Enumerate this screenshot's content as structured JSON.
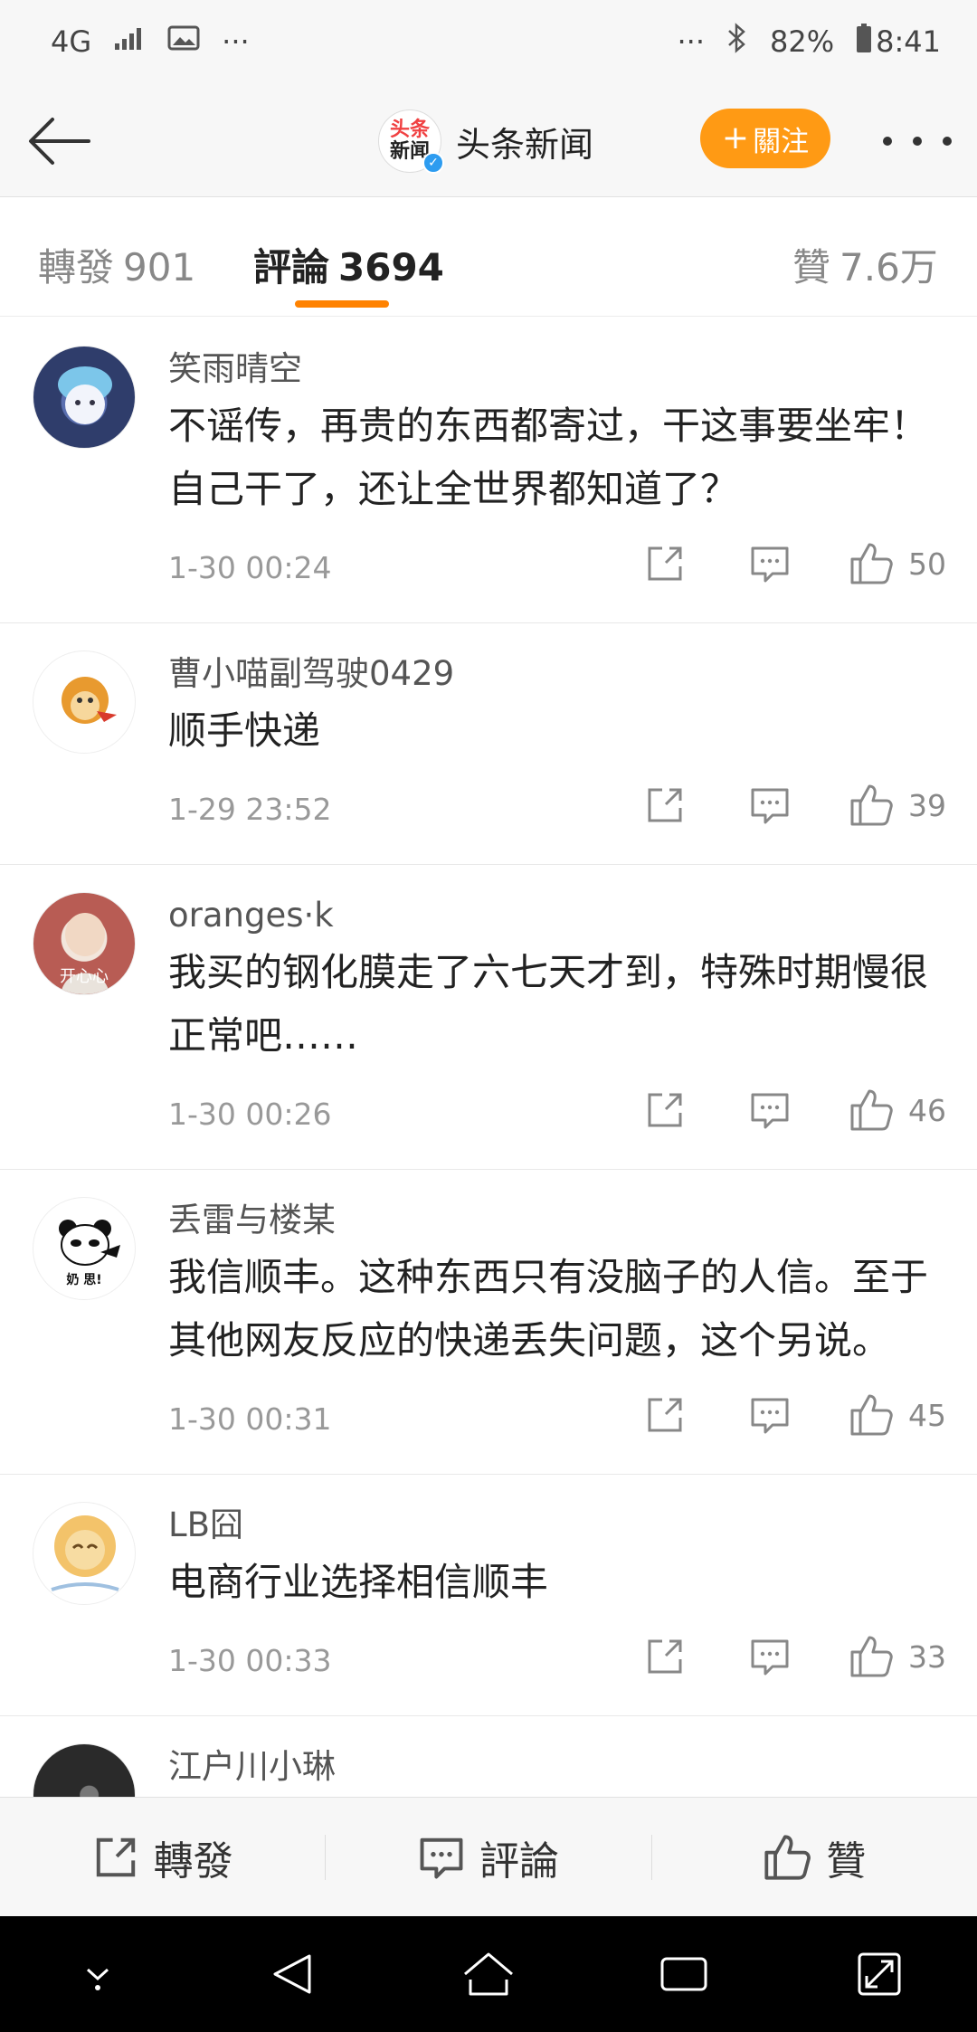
{
  "status_bar": {
    "network": "4G",
    "more_left": "···",
    "more_right": "···",
    "battery": "82%",
    "time": "8:41"
  },
  "header": {
    "account_name": "头条新闻",
    "logo_line1": "头条",
    "logo_line2": "新闻",
    "follow_plus": "+",
    "follow_label": "關注"
  },
  "tabs": [
    {
      "label": "轉發",
      "count": "901"
    },
    {
      "label": "評論",
      "count": "3694"
    },
    {
      "label": "贊",
      "count": "7.6万"
    }
  ],
  "comments": [
    {
      "username": "笑雨晴空",
      "text": "不谣传，再贵的东西都寄过，干这事要坐牢！自己干了，还让全世界都知道了？",
      "time": "1-30 00:24",
      "likes": "50",
      "avatar_icon": "cat-in-hat-avatar",
      "avatar_color": "#2f3d6b"
    },
    {
      "username": "曹小喵副驾驶0429",
      "text": "顺手快递",
      "time": "1-29 23:52",
      "likes": "39",
      "avatar_icon": "monkey-cartoon-avatar",
      "avatar_color": "#f0a53a"
    },
    {
      "username": "oranges·k",
      "text": "我买的钢化膜走了六七天才到，特殊时期慢很正常吧……",
      "time": "1-30 00:26",
      "likes": "46",
      "avatar_icon": "person-photo-avatar",
      "avatar_text": "开心心",
      "avatar_color": "#b85c54"
    },
    {
      "username": "丢雷与楼某",
      "text": "我信顺丰。这种东西只有没脑子的人信。至于其他网友反应的快递丢失问题，这个另说。",
      "time": "1-30 00:31",
      "likes": "45",
      "avatar_icon": "panda-meme-avatar",
      "avatar_text": "奶 思!",
      "avatar_color": "#ffffff"
    },
    {
      "username": "LB囧",
      "text": "电商行业选择相信顺丰",
      "time": "1-30 00:33",
      "likes": "33",
      "avatar_icon": "lion-cartoon-avatar",
      "avatar_color": "#f3c36a"
    },
    {
      "username": "江户川小琳",
      "text": "",
      "time": "",
      "likes": "",
      "avatar_icon": "dark-photo-avatar",
      "avatar_color": "#2a2a2a"
    }
  ],
  "bottom_bar": {
    "repost_label": "轉發",
    "comment_label": "評論",
    "like_label": "贊"
  },
  "colors": {
    "accent": "#ff8200",
    "follow_button": "#ff9a14",
    "verified_badge": "#2d9cf0"
  },
  "icons": {
    "back": "arrow-left-icon",
    "more": "more-dots-icon",
    "share": "share-box-icon",
    "reply": "comment-bubble-icon",
    "like": "thumbs-up-icon"
  }
}
